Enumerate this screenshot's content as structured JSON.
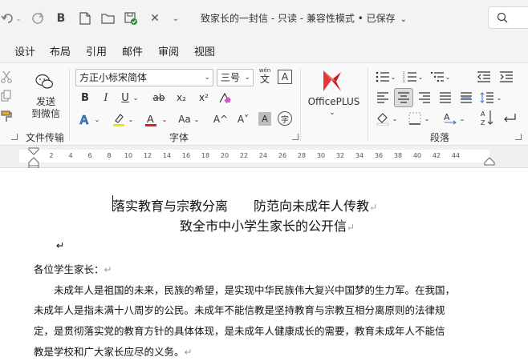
{
  "titlebar": {
    "title": "致家长的一封信 - 只读 - 兼容性模式 • 已保存",
    "bold_label": "B"
  },
  "menu": [
    "设计",
    "布局",
    "引用",
    "邮件",
    "审阅",
    "视图"
  ],
  "ribbon": {
    "send_wechat": "发送\n到微信",
    "clipboard_group": "文件传输",
    "font_name": "方正小标宋简体",
    "font_size": "三号",
    "pinyin_top": "wén",
    "pinyin_char": "文",
    "boxed_a": "A",
    "bold": "B",
    "italic": "I",
    "underline": "U",
    "strike": "ab",
    "subscript": "x₂",
    "superscript": "x²",
    "grow": "A^",
    "shrink": "A˅",
    "change_case": "Aa",
    "char_shading": "A",
    "enclose": "字",
    "font_group": "字体",
    "officeplus": "OfficePLUS",
    "paragraph_group": "段落"
  },
  "ruler": {
    "ticks": [
      "2",
      "4",
      "6",
      "8",
      "10",
      "12",
      "14",
      "16",
      "18",
      "20",
      "22",
      "24",
      "26",
      "28",
      "30",
      "32",
      "34",
      "36",
      "38",
      "40",
      "42",
      "44"
    ]
  },
  "document": {
    "title_line1": "落实教育与宗教分离　　防范向未成年人传教",
    "title_line2": "致全市中小学生家长的公开信",
    "salutation": "各位学生家长：",
    "body_lines": [
      "　　未成年人是祖国的未来，民族的希望，是实现中华民族伟大复兴中国梦的生力军。在我国，",
      "未成年人是指未满十八周岁的公民。未成年不能信教是坚持教育与宗教互相分离原则的法律规",
      "定，是贯彻落实党的教育方针的具体体现，是未成年人健康成长的需要，教育未成年人不能信",
      "教是学校和广大家长应尽的义务。"
    ],
    "para_mark": "↵"
  }
}
